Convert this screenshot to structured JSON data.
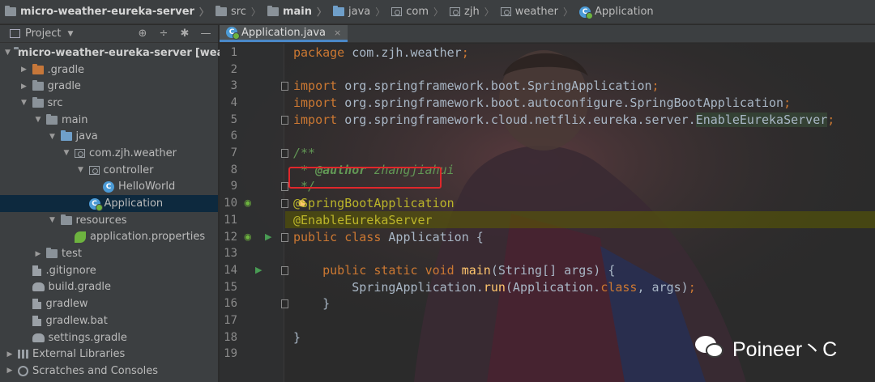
{
  "breadcrumb": {
    "items": [
      {
        "label": "micro-weather-eureka-server",
        "bold": true
      },
      {
        "label": "src"
      },
      {
        "label": "main",
        "bold": true
      },
      {
        "label": "java"
      },
      {
        "label": "com"
      },
      {
        "label": "zjh"
      },
      {
        "label": "weather"
      },
      {
        "label": "Application"
      }
    ]
  },
  "project_panel": {
    "title": "Project",
    "tools": {
      "locate": "⊕",
      "collapse": "÷",
      "settings": "✱",
      "hide": "—"
    },
    "tree": [
      {
        "label": "micro-weather-eureka-server",
        "suffix": "[weather]",
        "indent": 0,
        "arrow": "▼",
        "icon": "folder"
      },
      {
        "label": ".gradle",
        "indent": 1,
        "arrow": "▶",
        "icon": "folder-orange"
      },
      {
        "label": "gradle",
        "indent": 1,
        "arrow": "▶",
        "icon": "folder"
      },
      {
        "label": "src",
        "indent": 1,
        "arrow": "▼",
        "icon": "folder"
      },
      {
        "label": "main",
        "indent": 2,
        "arrow": "▼",
        "icon": "folder"
      },
      {
        "label": "java",
        "indent": 3,
        "arrow": "▼",
        "icon": "folder-blue"
      },
      {
        "label": "com.zjh.weather",
        "indent": 4,
        "arrow": "▼",
        "icon": "package"
      },
      {
        "label": "controller",
        "indent": 5,
        "arrow": "▼",
        "icon": "package"
      },
      {
        "label": "HelloWorld",
        "indent": 6,
        "arrow": "",
        "icon": "class"
      },
      {
        "label": "Application",
        "indent": 5,
        "arrow": "",
        "icon": "spring-class",
        "selected": true
      },
      {
        "label": "resources",
        "indent": 3,
        "arrow": "▼",
        "icon": "folder"
      },
      {
        "label": "application.properties",
        "indent": 4,
        "arrow": "",
        "icon": "spring-leaf"
      },
      {
        "label": "test",
        "indent": 2,
        "arrow": "▶",
        "icon": "folder"
      },
      {
        "label": ".gitignore",
        "indent": 1,
        "arrow": "",
        "icon": "file"
      },
      {
        "label": "build.gradle",
        "indent": 1,
        "arrow": "",
        "icon": "gradle"
      },
      {
        "label": "gradlew",
        "indent": 1,
        "arrow": "",
        "icon": "file"
      },
      {
        "label": "gradlew.bat",
        "indent": 1,
        "arrow": "",
        "icon": "file"
      },
      {
        "label": "settings.gradle",
        "indent": 1,
        "arrow": "",
        "icon": "gradle"
      },
      {
        "label": "External Libraries",
        "indent": 0,
        "arrow": "▶",
        "icon": "library"
      },
      {
        "label": "Scratches and Consoles",
        "indent": 0,
        "arrow": "▶",
        "icon": "scratch"
      }
    ]
  },
  "editor": {
    "tab": {
      "label": "Application.java",
      "close": "×"
    },
    "line_numbers": [
      "1",
      "2",
      "3",
      "4",
      "5",
      "6",
      "7",
      "8",
      "9",
      "10",
      "11",
      "12",
      "13",
      "14",
      "15",
      "16",
      "17",
      "18",
      "19"
    ],
    "lines": [
      [
        {
          "t": "package ",
          "c": "kw"
        },
        {
          "t": "com.zjh.weather",
          "c": "pl"
        },
        {
          "t": ";",
          "c": "kw"
        }
      ],
      [],
      [
        {
          "t": "import ",
          "c": "kw"
        },
        {
          "t": "org.springframework.boot.SpringApplication",
          "c": "pl"
        },
        {
          "t": ";",
          "c": "kw"
        }
      ],
      [
        {
          "t": "import ",
          "c": "kw"
        },
        {
          "t": "org.springframework.boot.autoconfigure.SpringBootApplication",
          "c": "pl"
        },
        {
          "t": ";",
          "c": "kw"
        }
      ],
      [
        {
          "t": "import ",
          "c": "kw"
        },
        {
          "t": "org.springframework.cloud.netflix.eureka.server.",
          "c": "pl"
        },
        {
          "t": "EnableEurekaServer",
          "c": "pl match"
        },
        {
          "t": ";",
          "c": "kw"
        }
      ],
      [],
      [
        {
          "t": "/**",
          "c": "cm"
        }
      ],
      [
        {
          "t": " * ",
          "c": "cm"
        },
        {
          "t": "@author",
          "c": "doctag"
        },
        {
          "t": " zhangjiahui",
          "c": "cm"
        }
      ],
      [
        {
          "t": " */",
          "c": "cm"
        }
      ],
      [
        {
          "t": "@SpringBootApplication",
          "c": "ann"
        }
      ],
      [
        {
          "t": "@EnableEurekaServer",
          "c": "ann"
        }
      ],
      [
        {
          "t": "public ",
          "c": "kw"
        },
        {
          "t": "class ",
          "c": "kw"
        },
        {
          "t": "Application {",
          "c": "pl"
        }
      ],
      [],
      [
        {
          "t": "    public ",
          "c": "kw"
        },
        {
          "t": "static ",
          "c": "kw"
        },
        {
          "t": "void ",
          "c": "kw"
        },
        {
          "t": "main",
          "c": "fn"
        },
        {
          "t": "(String[] args) {",
          "c": "pl"
        }
      ],
      [
        {
          "t": "        SpringApplication.",
          "c": "pl"
        },
        {
          "t": "run",
          "c": "fn"
        },
        {
          "t": "(Application.",
          "c": "pl"
        },
        {
          "t": "class",
          "c": "kw"
        },
        {
          "t": ", args)",
          "c": "pl"
        },
        {
          "t": ";",
          "c": "kw"
        }
      ],
      [
        {
          "t": "    }",
          "c": "pl"
        }
      ],
      [],
      [
        {
          "t": "}",
          "c": "pl"
        }
      ],
      []
    ],
    "highlighted_line": 11
  },
  "watermark": {
    "text": "Poineer丶C"
  }
}
